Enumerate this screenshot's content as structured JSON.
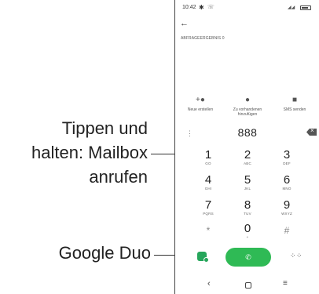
{
  "callouts": {
    "mailbox": [
      "Tippen und",
      "halten: Mailbox",
      "anrufen"
    ],
    "duo": "Google Duo"
  },
  "status_bar": {
    "time": "10:42",
    "icons": [
      "gear-icon",
      "message-icon",
      "signal-icon",
      "battery-icon"
    ]
  },
  "header": {
    "back_icon": "back-arrow-icon",
    "query_label": "ABFRAGEERGEBNIS 0"
  },
  "actions": [
    {
      "label": "Neue erstellen",
      "icon": "add-person-icon"
    },
    {
      "label": "Zu vorhandenen",
      "label2": "hinzufügen",
      "icon": "person-icon"
    },
    {
      "label": "SMS senden",
      "icon": "message-icon"
    }
  ],
  "dialer": {
    "number": "888",
    "keys": [
      {
        "num": "1",
        "letters": "GO"
      },
      {
        "num": "2",
        "letters": "ABC"
      },
      {
        "num": "3",
        "letters": "DEF"
      },
      {
        "num": "4",
        "letters": "GHI"
      },
      {
        "num": "5",
        "letters": "JKL"
      },
      {
        "num": "6",
        "letters": "MNO"
      },
      {
        "num": "7",
        "letters": "PQRS"
      },
      {
        "num": "8",
        "letters": "TUV"
      },
      {
        "num": "9",
        "letters": "WXYZ"
      },
      {
        "num": "*",
        "letters": ""
      },
      {
        "num": "0",
        "letters": "+"
      },
      {
        "num": "#",
        "letters": ""
      }
    ]
  },
  "bottom": {
    "duo_icon": "google-duo-icon",
    "call_icon": "phone-icon",
    "grid_icon": "dialpad-icon"
  },
  "nav": {
    "back": "‹",
    "menu": "≡"
  },
  "colors": {
    "call_green": "#2fba55",
    "duo_green": "#26a65b"
  }
}
